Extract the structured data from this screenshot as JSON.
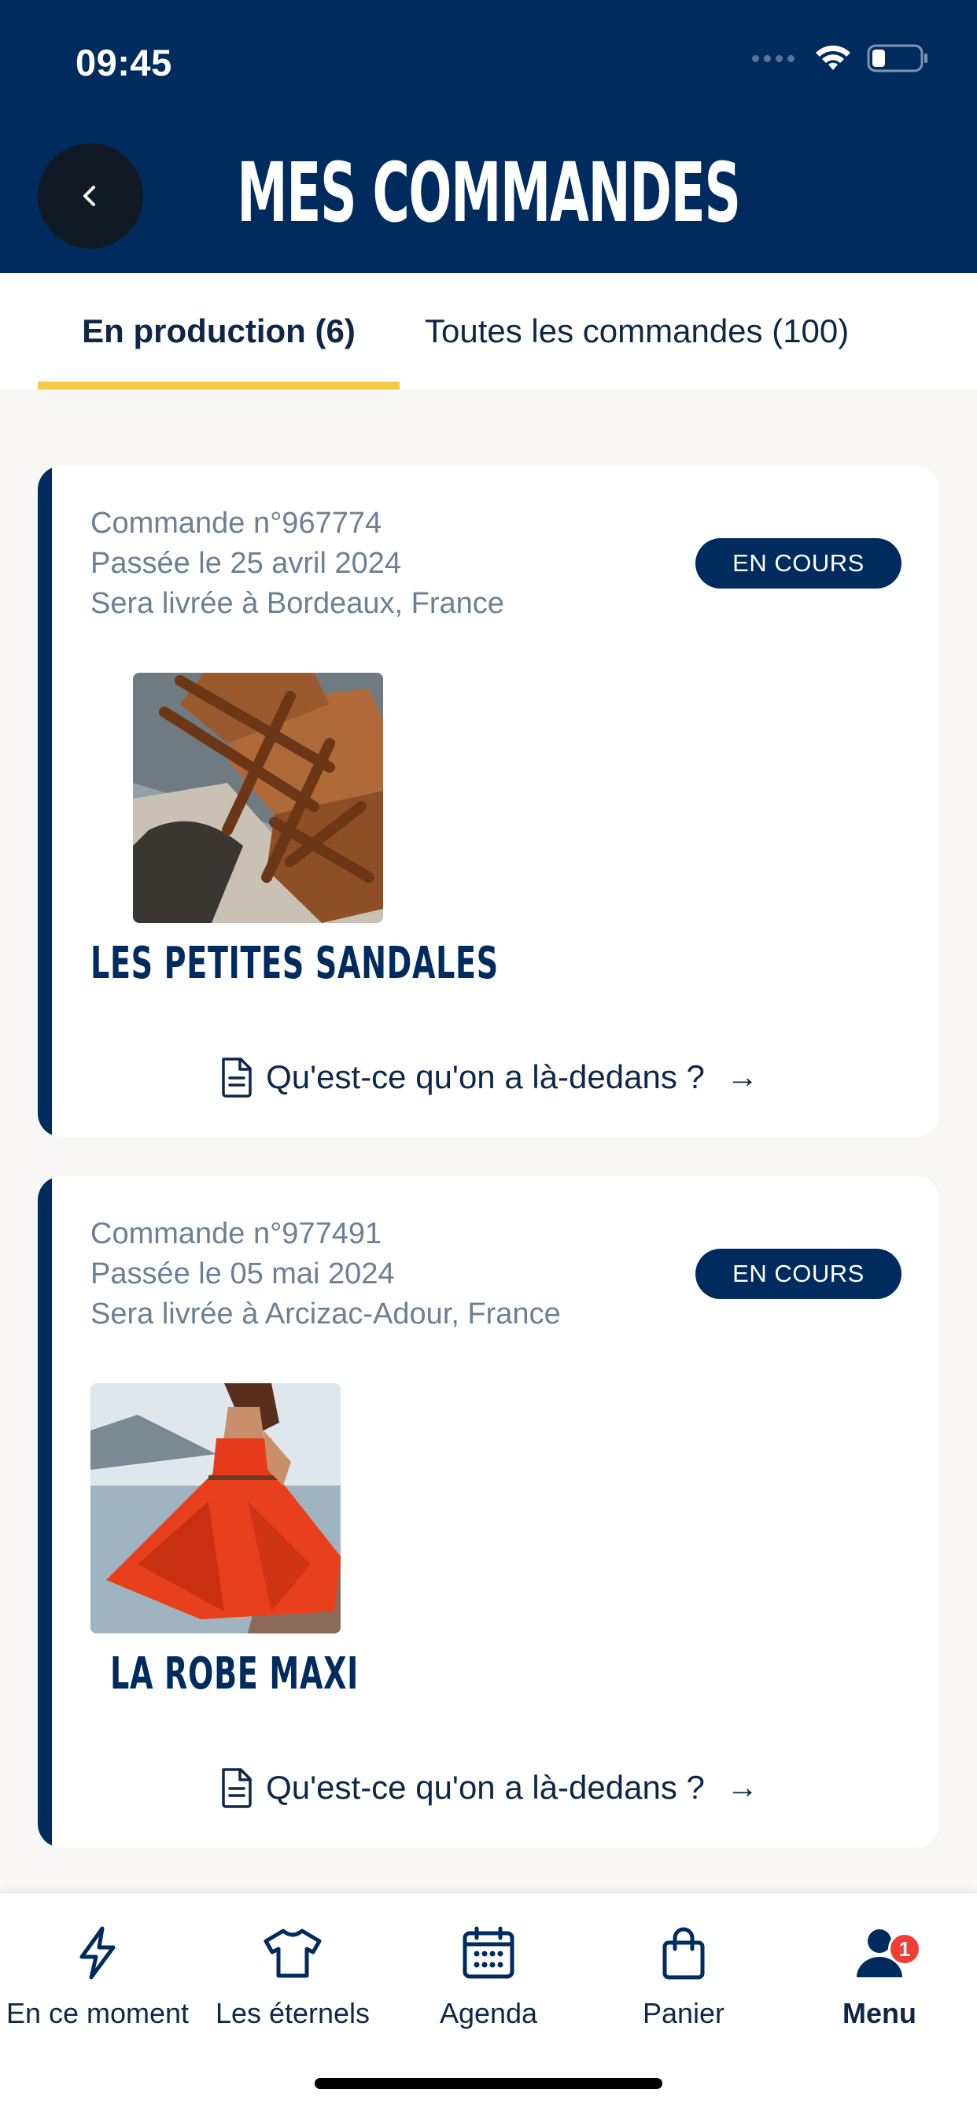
{
  "status_bar": {
    "time": "09:45"
  },
  "header": {
    "title": "MES COMMANDES"
  },
  "tabs": [
    {
      "label": "En production (6)",
      "active": true
    },
    {
      "label": "Toutes les commandes (100)",
      "active": false
    }
  ],
  "orders": [
    {
      "number": "Commande n°967774",
      "date": "Passée le 25 avril 2024",
      "delivery": "Sera livrée à Bordeaux, France",
      "status": "EN COURS",
      "product": "LES PETITES SANDALES",
      "link": "Qu'est-ce qu'on a là-dedans ?"
    },
    {
      "number": "Commande n°977491",
      "date": "Passée le 05 mai 2024",
      "delivery": "Sera livrée à Arcizac-Adour, France",
      "status": "EN COURS",
      "product": "LA ROBE MAXI",
      "link": "Qu'est-ce qu'on a là-dedans ?"
    }
  ],
  "bottom_nav": [
    {
      "label": "En ce moment",
      "icon": "lightning-icon"
    },
    {
      "label": "Les éternels",
      "icon": "tshirt-icon"
    },
    {
      "label": "Agenda",
      "icon": "calendar-icon"
    },
    {
      "label": "Panier",
      "icon": "bag-icon"
    },
    {
      "label": "Menu",
      "icon": "user-icon",
      "badge": "1",
      "active": true
    }
  ],
  "colors": {
    "brand": "#002b5e",
    "accent": "#f7c948",
    "badge": "#ef3e36",
    "background": "#f8f7f5"
  }
}
